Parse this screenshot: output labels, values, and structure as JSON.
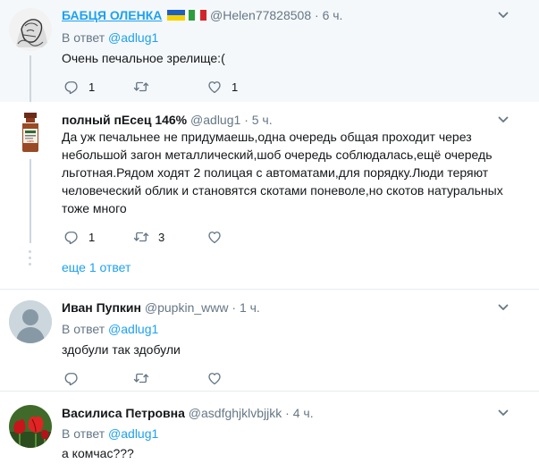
{
  "tweets": [
    {
      "name": "БАБЦЯ ОЛЕНКА",
      "handle": "@Helen77828508",
      "dot": "·",
      "time": "6 ч.",
      "reply_prefix": "В ответ",
      "reply_mention": "@adlug1",
      "text": "Очень печальное зрелище:(",
      "replies": "1",
      "retweets": "",
      "likes": "1"
    },
    {
      "name": "полный пЕсец 146%",
      "handle": "@adlug1",
      "dot": "·",
      "time": "5 ч.",
      "text_lines": [
        "Да уж печальнее не придумаешь,одна очередь общая проходит через",
        "небольшой загон металлический,шоб очередь соблюдалась,ещё очередь",
        "льготная.Рядом ходят 2 полицая с автоматами,для порядку.Люди теряют",
        "человеческий облик и становятся скотами поневоле,но скотов натуральных",
        "тоже много"
      ],
      "replies": "1",
      "retweets": "3",
      "likes": "",
      "more_replies": "еще 1 ответ"
    },
    {
      "name": "Иван Пупкин",
      "handle": "@pupkin_www",
      "dot": "·",
      "time": "1 ч.",
      "reply_prefix": "В ответ",
      "reply_mention": "@adlug1",
      "text": "здобули так здобули",
      "replies": "",
      "retweets": "",
      "likes": ""
    },
    {
      "name": "Василиса Петровна",
      "handle": "@asdfghjklvbjjkk",
      "dot": "·",
      "time": "4 ч.",
      "reply_prefix": "В ответ",
      "reply_mention": "@adlug1",
      "text": "а комчас???"
    }
  ],
  "icons": {
    "reply": "reply-icon",
    "retweet": "retweet-icon",
    "like": "heart-icon",
    "caret": "chevron-down-icon"
  },
  "colors": {
    "accent": "#1da1f2",
    "muted": "#657786",
    "highlight_bg": "#f5f8fa"
  }
}
